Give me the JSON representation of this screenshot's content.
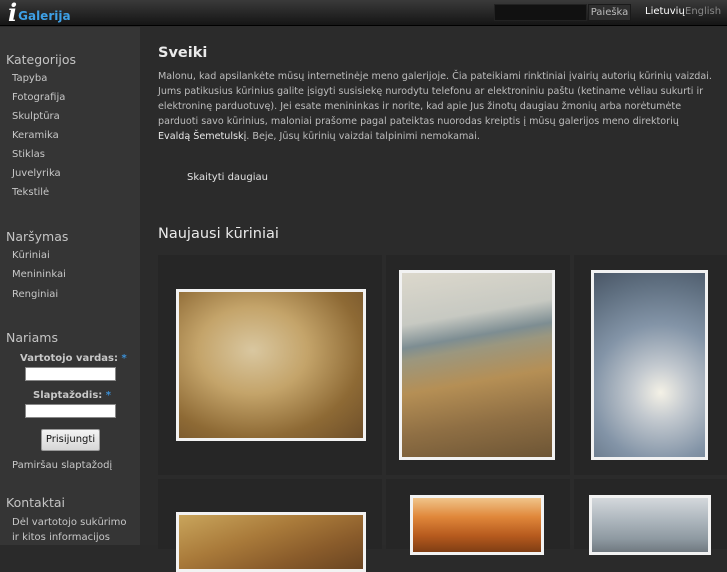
{
  "header": {
    "logo_mark": "i",
    "logo_text": "Galerija",
    "search_placeholder": "",
    "search_button": "Paieška",
    "lang_current": "Lietuvių",
    "lang_other": "English"
  },
  "sidebar": {
    "categories_title": "Kategorijos",
    "categories": [
      "Tapyba",
      "Fotografija",
      "Skulptūra",
      "Keramika",
      "Stiklas",
      "Juvelyrika",
      "Tekstilė"
    ],
    "browse_title": "Naršymas",
    "browse": [
      "Kūriniai",
      "Menininkai",
      "Renginiai"
    ],
    "members_title": "Nariams",
    "username_label": "Vartotojo vardas:",
    "password_label": "Slaptažodis:",
    "required_mark": "*",
    "login_button": "Prisijungti",
    "forgot_password": "Pamiršau slaptažodį",
    "contacts_title": "Kontaktai",
    "contacts_line1": "Dėl vartotojo sukūrimo",
    "contacts_line2": "ir kitos informacijos"
  },
  "main": {
    "welcome_title": "Sveiki",
    "intro_before": "Malonu, kad apsilankėte mūsų internetinėje meno galerijoje. Čia pateikiami rinktiniai įvairių autorių kūrinių vaizdai. Jums patikusius kūrinius galite įsigyti susisiekę nurodytu telefonu ar elektroniniu paštu (ketiname vėliau sukurti ir elektroninę parduotuvę). Jei esate menininkas ir norite, kad apie Jus žinotų daugiau žmonių arba norėtumėte parduoti savo kūrinius, maloniai prašome pagal pateiktas nuorodas kreiptis į mūsų galerijos meno direktorių",
    "intro_link": "Evaldą Šemetulskį",
    "intro_after": ". Beje, Jūsų kūrinių vaizdai talpinimi nemokamai.",
    "read_more": "Skaityti daugiau",
    "newest_title": "Naujausi kūriniai"
  }
}
